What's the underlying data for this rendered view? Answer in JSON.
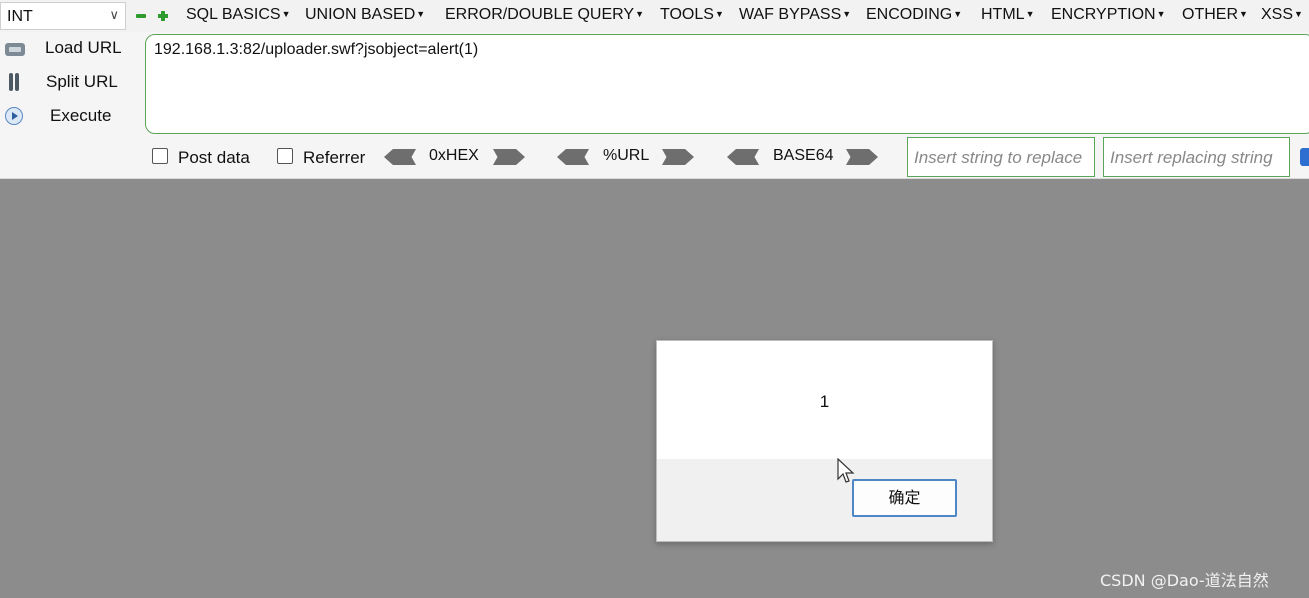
{
  "menu": {
    "int_select": "INT",
    "items": [
      {
        "label": "SQL BASICS"
      },
      {
        "label": "UNION BASED"
      },
      {
        "label": "ERROR/DOUBLE QUERY"
      },
      {
        "label": "TOOLS"
      },
      {
        "label": "WAF BYPASS"
      },
      {
        "label": "ENCODING"
      },
      {
        "label": "HTML"
      },
      {
        "label": "ENCRYPTION"
      },
      {
        "label": "OTHER"
      },
      {
        "label": "XSS"
      }
    ]
  },
  "actions": {
    "load_url": "Load URL",
    "split_url": "Split URL",
    "execute": "Execute"
  },
  "url_value": "192.168.1.3:82/uploader.swf?jsobject=alert(1)",
  "options": {
    "post_data": "Post data",
    "referrer": "Referrer",
    "hex": "0xHEX",
    "url_enc": "%URL",
    "base64": "BASE64",
    "replace_placeholder": "Insert string to replace",
    "replacing_placeholder": "Insert replacing string"
  },
  "alert": {
    "message": "1",
    "ok": "确定"
  },
  "watermark": "CSDN @Dao-道法自然",
  "colors": {
    "page_background": "#8c8c8c",
    "url_border": "#5aa55a",
    "button_border": "#4f86c6"
  }
}
